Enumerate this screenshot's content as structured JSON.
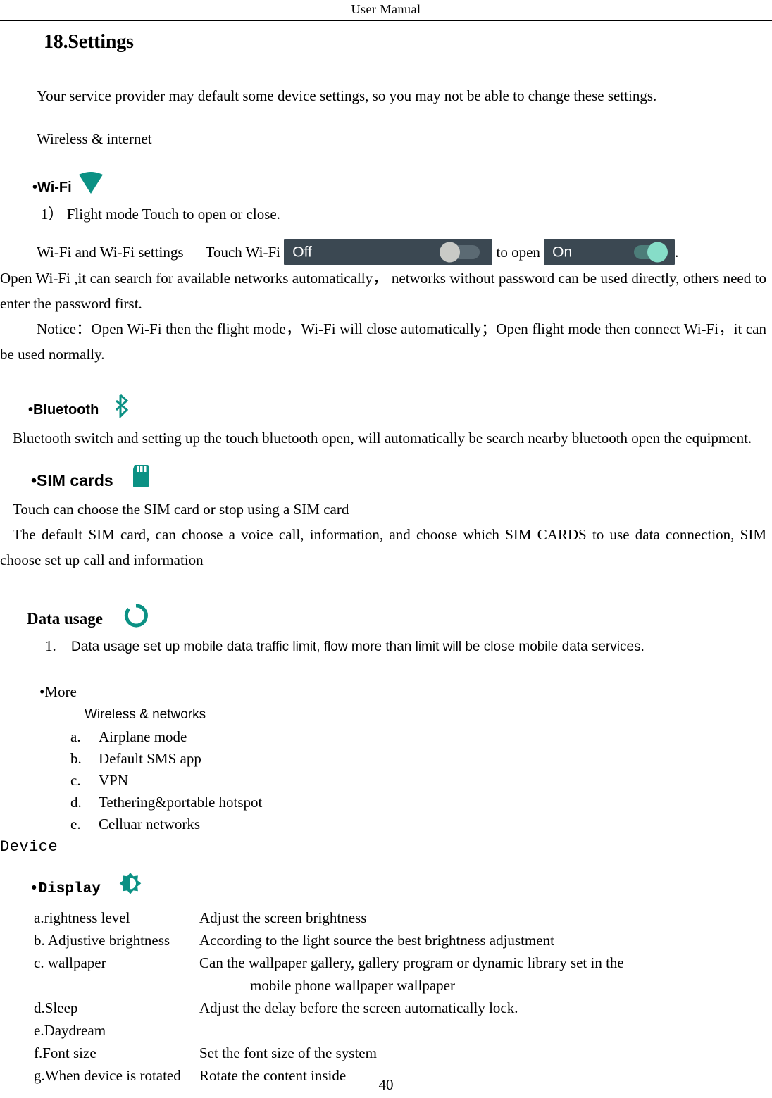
{
  "header": {
    "title": "User   Manual"
  },
  "page_number": "40",
  "chapter": {
    "title": "18.Settings",
    "intro": "Your service provider may default some device settings, so you may not be able to change these settings."
  },
  "sections": {
    "wireless_internet_heading": "Wireless & internet",
    "wifi": {
      "label": "•Wi-Fi",
      "icon": "wifi-icon",
      "item1": "1） Flight mode    Touch to open or close.",
      "settings_prefix": "Wi-Fi and Wi-Fi settings      Touch Wi-Fi ",
      "settings_middle": " to open ",
      "settings_suffix": ".",
      "toggle_off_label": "Off",
      "toggle_on_label": "On",
      "body": "Open Wi-Fi ,it can search for available networks automatically， networks without password can be used directly, others need to enter the password first.",
      "notice": "Notice：Open Wi-Fi then the flight mode，Wi-Fi will close automatically；Open flight mode then connect Wi-Fi，it can be used normally."
    },
    "bluetooth": {
      "label": "•Bluetooth",
      "icon": "bluetooth-icon",
      "body": "Bluetooth switch and setting up the touch bluetooth open, will automatically be search nearby bluetooth open the equipment."
    },
    "sim_cards": {
      "label": "•SIM cards",
      "icon": "sim-card-icon",
      "line1": "Touch can choose the SIM card or stop using a SIM card",
      "line2": "The default SIM card, can choose a voice call, information, and choose which SIM CARDS to use data connection, SIM choose set up call and information"
    },
    "data_usage": {
      "label": "Data usage",
      "icon": "data-usage-icon",
      "item_marker": "1.",
      "item_text": "Data usage   set up mobile data traffic limit, flow more than limit will be close mobile data services."
    },
    "more": {
      "label": "•More",
      "subheading": "Wireless & networks",
      "items": [
        {
          "marker": "a.",
          "label": "Airplane mode"
        },
        {
          "marker": "b.",
          "label": "Default SMS app"
        },
        {
          "marker": "c.",
          "label": "VPN"
        },
        {
          "marker": "d.",
          "label": "Tethering&portable hotspot"
        },
        {
          "marker": "e.",
          "label": "Celluar networks"
        }
      ]
    },
    "device": {
      "heading": "Device",
      "display": {
        "label": "•Display",
        "icon": "brightness-icon",
        "rows": [
          {
            "name": "a.rightness level",
            "desc": "Adjust the screen brightness"
          },
          {
            "name": "b. Adjustive brightness",
            "desc": " According to the light source the best brightness adjustment"
          },
          {
            "name": "c. wallpaper",
            "desc": "Can the wallpaper gallery, gallery program or dynamic library set in the"
          },
          {
            "name": "",
            "desc": " mobile phone wallpaper wallpaper"
          },
          {
            "name": "d.Sleep",
            "desc": " Adjust the delay before the screen automatically lock."
          },
          {
            "name": "e.Daydream",
            "desc": ""
          },
          {
            "name": "f.Font size",
            "desc": "Set the font size of the system"
          },
          {
            "name": "g.When device is rotated",
            "desc": " Rotate the content inside"
          }
        ]
      }
    }
  },
  "colors": {
    "teal": "#009688",
    "toggle_bg": "#3b4852",
    "toggle_track_off": "#5b6a73",
    "toggle_knob_off": "#c9cac6",
    "toggle_track_on": "#4c7d79",
    "toggle_knob_on": "#86ddc8"
  }
}
